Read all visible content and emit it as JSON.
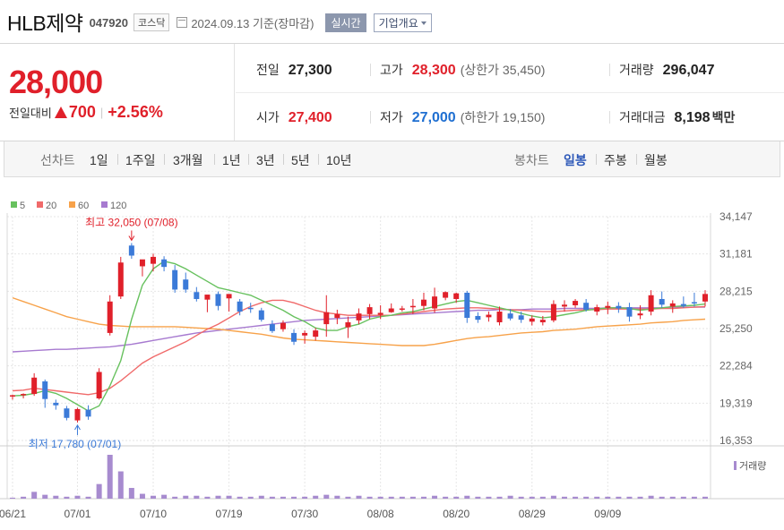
{
  "header": {
    "name": "HLB제약",
    "code": "047920",
    "market": "코스닥",
    "date": "2024.09.13 기준(장마감)",
    "realtime_label": "실시간",
    "company_label": "기업개요"
  },
  "quote": {
    "price": "28,000",
    "change_label": "전일대비",
    "change": "700",
    "change_pct": "+2.56%",
    "prev_close_label": "전일",
    "prev_close": "27,300",
    "open_label": "시가",
    "open": "27,400",
    "high_label": "고가",
    "high": "28,300",
    "upper_limit_label": "(상한가",
    "upper_limit": "35,450)",
    "low_label": "저가",
    "low": "27,000",
    "lower_limit_label": "(하한가",
    "lower_limit": "19,150)",
    "volume_label": "거래량",
    "volume": "296,047",
    "amount_label": "거래대금",
    "amount": "8,198",
    "amount_unit": "백만"
  },
  "period_bar": {
    "line_label": "선차트",
    "line_periods": [
      "1일",
      "1주일",
      "3개월",
      "1년",
      "3년",
      "5년",
      "10년"
    ],
    "candle_label": "봉차트",
    "candle_periods": [
      "일봉",
      "주봉",
      "월봉"
    ],
    "candle_active": "일봉"
  },
  "colors": {
    "up": "#e0202a",
    "down": "#3b7ad8",
    "ma5": "#67c15e",
    "ma20": "#f06a6a",
    "ma60": "#f7a24a",
    "ma120": "#a77ad0",
    "volume": "#a78bcf"
  },
  "chart_data": {
    "type": "candlestick",
    "legend": [
      {
        "name": "5",
        "color": "#67c15e"
      },
      {
        "name": "20",
        "color": "#f06a6a"
      },
      {
        "name": "60",
        "color": "#f7a24a"
      },
      {
        "name": "120",
        "color": "#a77ad0"
      }
    ],
    "y_ticks": [
      "34,147",
      "31,181",
      "28,215",
      "25,250",
      "22,284",
      "19,319",
      "16,353"
    ],
    "ylim": [
      16353,
      34147
    ],
    "x_tick_labels": [
      {
        "index": 0,
        "label": "06/21"
      },
      {
        "index": 6,
        "label": "07/01"
      },
      {
        "index": 13,
        "label": "07/10"
      },
      {
        "index": 20,
        "label": "07/19"
      },
      {
        "index": 27,
        "label": "07/30"
      },
      {
        "index": 34,
        "label": "08/08"
      },
      {
        "index": 41,
        "label": "08/20"
      },
      {
        "index": 48,
        "label": "08/29"
      },
      {
        "index": 55,
        "label": "09/09"
      }
    ],
    "annotations": {
      "high": {
        "text": "최고 32,050 (07/08)",
        "index": 11,
        "value": 32050
      },
      "low": {
        "text": "최저 17,780 (07/01)",
        "index": 6,
        "value": 17780
      }
    },
    "volume_label": "거래량",
    "candles": [
      {
        "o": 19850,
        "h": 20000,
        "l": 19600,
        "c": 19950
      },
      {
        "o": 19950,
        "h": 20100,
        "l": 19700,
        "c": 20050
      },
      {
        "o": 20050,
        "h": 21700,
        "l": 19900,
        "c": 21350
      },
      {
        "o": 21050,
        "h": 21200,
        "l": 18950,
        "c": 19650
      },
      {
        "o": 19350,
        "h": 19600,
        "l": 18800,
        "c": 19150
      },
      {
        "o": 18900,
        "h": 19100,
        "l": 17950,
        "c": 18150
      },
      {
        "o": 17950,
        "h": 18950,
        "l": 17780,
        "c": 18850
      },
      {
        "o": 18800,
        "h": 19150,
        "l": 18000,
        "c": 18250
      },
      {
        "o": 19700,
        "h": 22100,
        "l": 19600,
        "c": 21800
      },
      {
        "o": 24900,
        "h": 27900,
        "l": 24700,
        "c": 27400
      },
      {
        "o": 27800,
        "h": 30950,
        "l": 27600,
        "c": 30500
      },
      {
        "o": 31850,
        "h": 32050,
        "l": 30800,
        "c": 31050
      },
      {
        "o": 30200,
        "h": 30700,
        "l": 29400,
        "c": 30750
      },
      {
        "o": 30400,
        "h": 31200,
        "l": 29800,
        "c": 30950
      },
      {
        "o": 30750,
        "h": 31000,
        "l": 29800,
        "c": 30150
      },
      {
        "o": 29900,
        "h": 30300,
        "l": 28100,
        "c": 28350
      },
      {
        "o": 29150,
        "h": 29700,
        "l": 28100,
        "c": 28350
      },
      {
        "o": 28150,
        "h": 28550,
        "l": 27400,
        "c": 27600
      },
      {
        "o": 27550,
        "h": 27800,
        "l": 26550,
        "c": 27950
      },
      {
        "o": 28000,
        "h": 28200,
        "l": 26700,
        "c": 27050
      },
      {
        "o": 27650,
        "h": 28000,
        "l": 26600,
        "c": 28000
      },
      {
        "o": 27400,
        "h": 27600,
        "l": 26300,
        "c": 26600
      },
      {
        "o": 26900,
        "h": 27300,
        "l": 26500,
        "c": 26800
      },
      {
        "o": 26700,
        "h": 26900,
        "l": 25800,
        "c": 25950
      },
      {
        "o": 25600,
        "h": 25900,
        "l": 24900,
        "c": 25050
      },
      {
        "o": 25200,
        "h": 25900,
        "l": 25000,
        "c": 25700
      },
      {
        "o": 24900,
        "h": 25200,
        "l": 23950,
        "c": 24200
      },
      {
        "o": 24700,
        "h": 25100,
        "l": 24050,
        "c": 24900
      },
      {
        "o": 24600,
        "h": 25300,
        "l": 24300,
        "c": 25100
      },
      {
        "o": 25600,
        "h": 27900,
        "l": 24600,
        "c": 26550
      },
      {
        "o": 26100,
        "h": 26750,
        "l": 25600,
        "c": 26400
      },
      {
        "o": 25350,
        "h": 26200,
        "l": 24500,
        "c": 25750
      },
      {
        "o": 25900,
        "h": 26850,
        "l": 25600,
        "c": 26450
      },
      {
        "o": 26400,
        "h": 27200,
        "l": 26000,
        "c": 26950
      },
      {
        "o": 26350,
        "h": 27100,
        "l": 26000,
        "c": 26500
      },
      {
        "o": 26550,
        "h": 27250,
        "l": 26500,
        "c": 26850
      },
      {
        "o": 26750,
        "h": 27050,
        "l": 26600,
        "c": 26850
      },
      {
        "o": 27000,
        "h": 27600,
        "l": 26400,
        "c": 27050
      },
      {
        "o": 27050,
        "h": 28100,
        "l": 26700,
        "c": 27550
      },
      {
        "o": 26850,
        "h": 28500,
        "l": 26500,
        "c": 27800
      },
      {
        "o": 27700,
        "h": 28200,
        "l": 27500,
        "c": 28150
      },
      {
        "o": 27600,
        "h": 28100,
        "l": 27300,
        "c": 28050
      },
      {
        "o": 28100,
        "h": 28250,
        "l": 25700,
        "c": 26100
      },
      {
        "o": 26250,
        "h": 26550,
        "l": 25700,
        "c": 25950
      },
      {
        "o": 26150,
        "h": 26600,
        "l": 25800,
        "c": 26350
      },
      {
        "o": 25750,
        "h": 27000,
        "l": 25500,
        "c": 26600
      },
      {
        "o": 26450,
        "h": 26800,
        "l": 25900,
        "c": 26050
      },
      {
        "o": 26300,
        "h": 26600,
        "l": 25700,
        "c": 25950
      },
      {
        "o": 25800,
        "h": 26300,
        "l": 25500,
        "c": 26050
      },
      {
        "o": 25750,
        "h": 26250,
        "l": 25500,
        "c": 25950
      },
      {
        "o": 25900,
        "h": 27500,
        "l": 25750,
        "c": 27200
      },
      {
        "o": 27000,
        "h": 27500,
        "l": 26600,
        "c": 27150
      },
      {
        "o": 27100,
        "h": 27600,
        "l": 26900,
        "c": 27450
      },
      {
        "o": 27300,
        "h": 27600,
        "l": 26600,
        "c": 26750
      },
      {
        "o": 26600,
        "h": 27150,
        "l": 26300,
        "c": 26950
      },
      {
        "o": 26900,
        "h": 27400,
        "l": 26400,
        "c": 27050
      },
      {
        "o": 27050,
        "h": 27350,
        "l": 26500,
        "c": 26850
      },
      {
        "o": 26950,
        "h": 27300,
        "l": 25800,
        "c": 26200
      },
      {
        "o": 26300,
        "h": 27100,
        "l": 26000,
        "c": 26450
      },
      {
        "o": 26600,
        "h": 28300,
        "l": 26300,
        "c": 27900
      },
      {
        "o": 27600,
        "h": 28200,
        "l": 26900,
        "c": 27150
      },
      {
        "o": 27000,
        "h": 27500,
        "l": 26500,
        "c": 27250
      },
      {
        "o": 27200,
        "h": 27800,
        "l": 26900,
        "c": 27050
      },
      {
        "o": 27350,
        "h": 28100,
        "l": 27000,
        "c": 27250
      },
      {
        "o": 27400,
        "h": 28300,
        "l": 27000,
        "c": 28000
      }
    ],
    "volumes": [
      1,
      2,
      7,
      4,
      3,
      2,
      3,
      2,
      15,
      45,
      28,
      11,
      5,
      3,
      4,
      2,
      3,
      3,
      2,
      3,
      3,
      2,
      2,
      3,
      2,
      2,
      2,
      2,
      3,
      4,
      3,
      2,
      3,
      2,
      2,
      2,
      2,
      2,
      2,
      3,
      2,
      2,
      3,
      2,
      2,
      2,
      3,
      2,
      2,
      2,
      3,
      2,
      2,
      2,
      2,
      2,
      2,
      2,
      2,
      3,
      2,
      2,
      2,
      2,
      2
    ],
    "ma5": [
      19900,
      19950,
      20100,
      20300,
      20100,
      19700,
      19200,
      18700,
      19100,
      20700,
      22700,
      26000,
      28700,
      30000,
      30600,
      30400,
      30000,
      29500,
      29000,
      28500,
      28300,
      28100,
      27900,
      27500,
      27100,
      26700,
      26200,
      25800,
      25300,
      25100,
      25100,
      25400,
      25600,
      26000,
      26200,
      26300,
      26500,
      26600,
      26800,
      27000,
      27200,
      27400,
      27500,
      27300,
      27100,
      26900,
      26700,
      26450,
      26250,
      26100,
      26200,
      26350,
      26500,
      26700,
      26800,
      26900,
      26900,
      26850,
      26700,
      26800,
      26900,
      27000,
      27050,
      27100,
      27200
    ],
    "ma20": [
      20300,
      20350,
      20500,
      20400,
      20300,
      20200,
      20100,
      20000,
      20150,
      20500,
      21100,
      21800,
      22500,
      23000,
      23400,
      23800,
      24200,
      24700,
      25200,
      25600,
      26100,
      26600,
      27000,
      27300,
      27500,
      27500,
      27300,
      27000,
      26700,
      26500,
      26400,
      26300,
      26300,
      26300,
      26300,
      26300,
      26400,
      26500,
      26600,
      26700,
      26800,
      26850,
      26900,
      26900,
      26850,
      26800,
      26750,
      26700,
      26650,
      26600,
      26600,
      26650,
      26700,
      26750,
      26750,
      26800,
      26800,
      26800,
      26800,
      26800,
      26850,
      26850,
      26900,
      26950,
      27000
    ],
    "ma60": [
      27700,
      27400,
      27100,
      26800,
      26500,
      26200,
      26000,
      25800,
      25600,
      25500,
      25450,
      25400,
      25400,
      25400,
      25400,
      25400,
      25350,
      25300,
      25250,
      25200,
      25100,
      25000,
      24900,
      24800,
      24650,
      24500,
      24400,
      24350,
      24300,
      24250,
      24200,
      24150,
      24100,
      24050,
      24000,
      23950,
      23900,
      23900,
      23900,
      24000,
      24150,
      24300,
      24450,
      24550,
      24600,
      24700,
      24800,
      24900,
      24950,
      25000,
      25100,
      25150,
      25200,
      25300,
      25400,
      25450,
      25500,
      25550,
      25600,
      25700,
      25750,
      25800,
      25900,
      25950,
      26000
    ],
    "ma120": [
      23400,
      23450,
      23500,
      23550,
      23600,
      23600,
      23650,
      23700,
      23750,
      23800,
      23900,
      24000,
      24150,
      24300,
      24450,
      24600,
      24750,
      24900,
      25000,
      25100,
      25200,
      25300,
      25400,
      25500,
      25600,
      25700,
      25800,
      25900,
      25950,
      26000,
      26050,
      26100,
      26150,
      26200,
      26250,
      26300,
      26350,
      26400,
      26450,
      26500,
      26550,
      26600,
      26650,
      26700,
      26700,
      26750,
      26750,
      26750,
      26800,
      26800,
      26800,
      26850,
      26850,
      26850,
      26850,
      26900,
      26900,
      26900,
      26900,
      26900,
      26900,
      26950,
      26950,
      26950,
      26950
    ]
  }
}
